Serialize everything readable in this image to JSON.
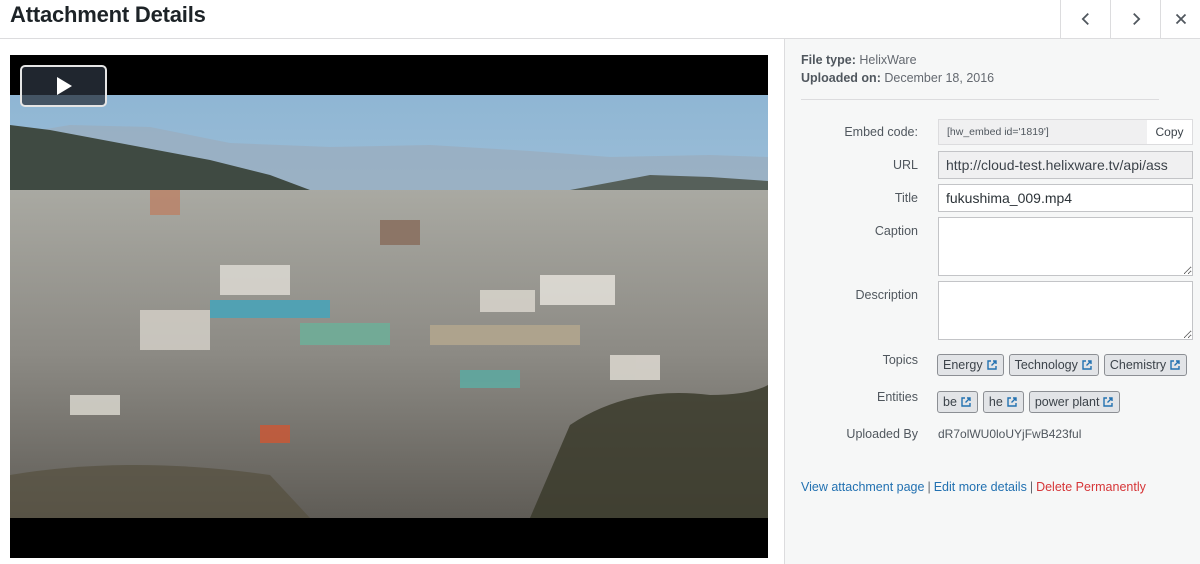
{
  "header": {
    "title": "Attachment Details",
    "prev_icon": "chevron-left-icon",
    "next_icon": "chevron-right-icon",
    "close_icon": "close-icon"
  },
  "media": {
    "play_icon": "play-icon"
  },
  "details": {
    "file_type_label": "File type:",
    "file_type_value": "HelixWare",
    "uploaded_label": "Uploaded on:",
    "uploaded_value": "December 18, 2016"
  },
  "fields": {
    "embed_label": "Embed code:",
    "embed_value": "[hw_embed id='1819']",
    "copy_label": "Copy",
    "url_label": "URL",
    "url_value": "http://cloud-test.helixware.tv/api/ass",
    "title_label": "Title",
    "title_value": "fukushima_009.mp4",
    "caption_label": "Caption",
    "caption_value": "",
    "description_label": "Description",
    "description_value": ""
  },
  "topics": {
    "label": "Topics",
    "items": [
      "Energy",
      "Technology",
      "Chemistry"
    ]
  },
  "entities": {
    "label": "Entities",
    "items": [
      "be",
      "he",
      "power plant"
    ]
  },
  "uploaded_by": {
    "label": "Uploaded By",
    "value": "dR7olWU0loUYjFwB423ful"
  },
  "actions": {
    "view": "View attachment page",
    "edit": "Edit more details",
    "delete": "Delete Permanently",
    "separator": "|"
  },
  "colors": {
    "link": "#2271b1",
    "danger": "#d63638",
    "sidebar_bg": "#f6f7f7"
  }
}
